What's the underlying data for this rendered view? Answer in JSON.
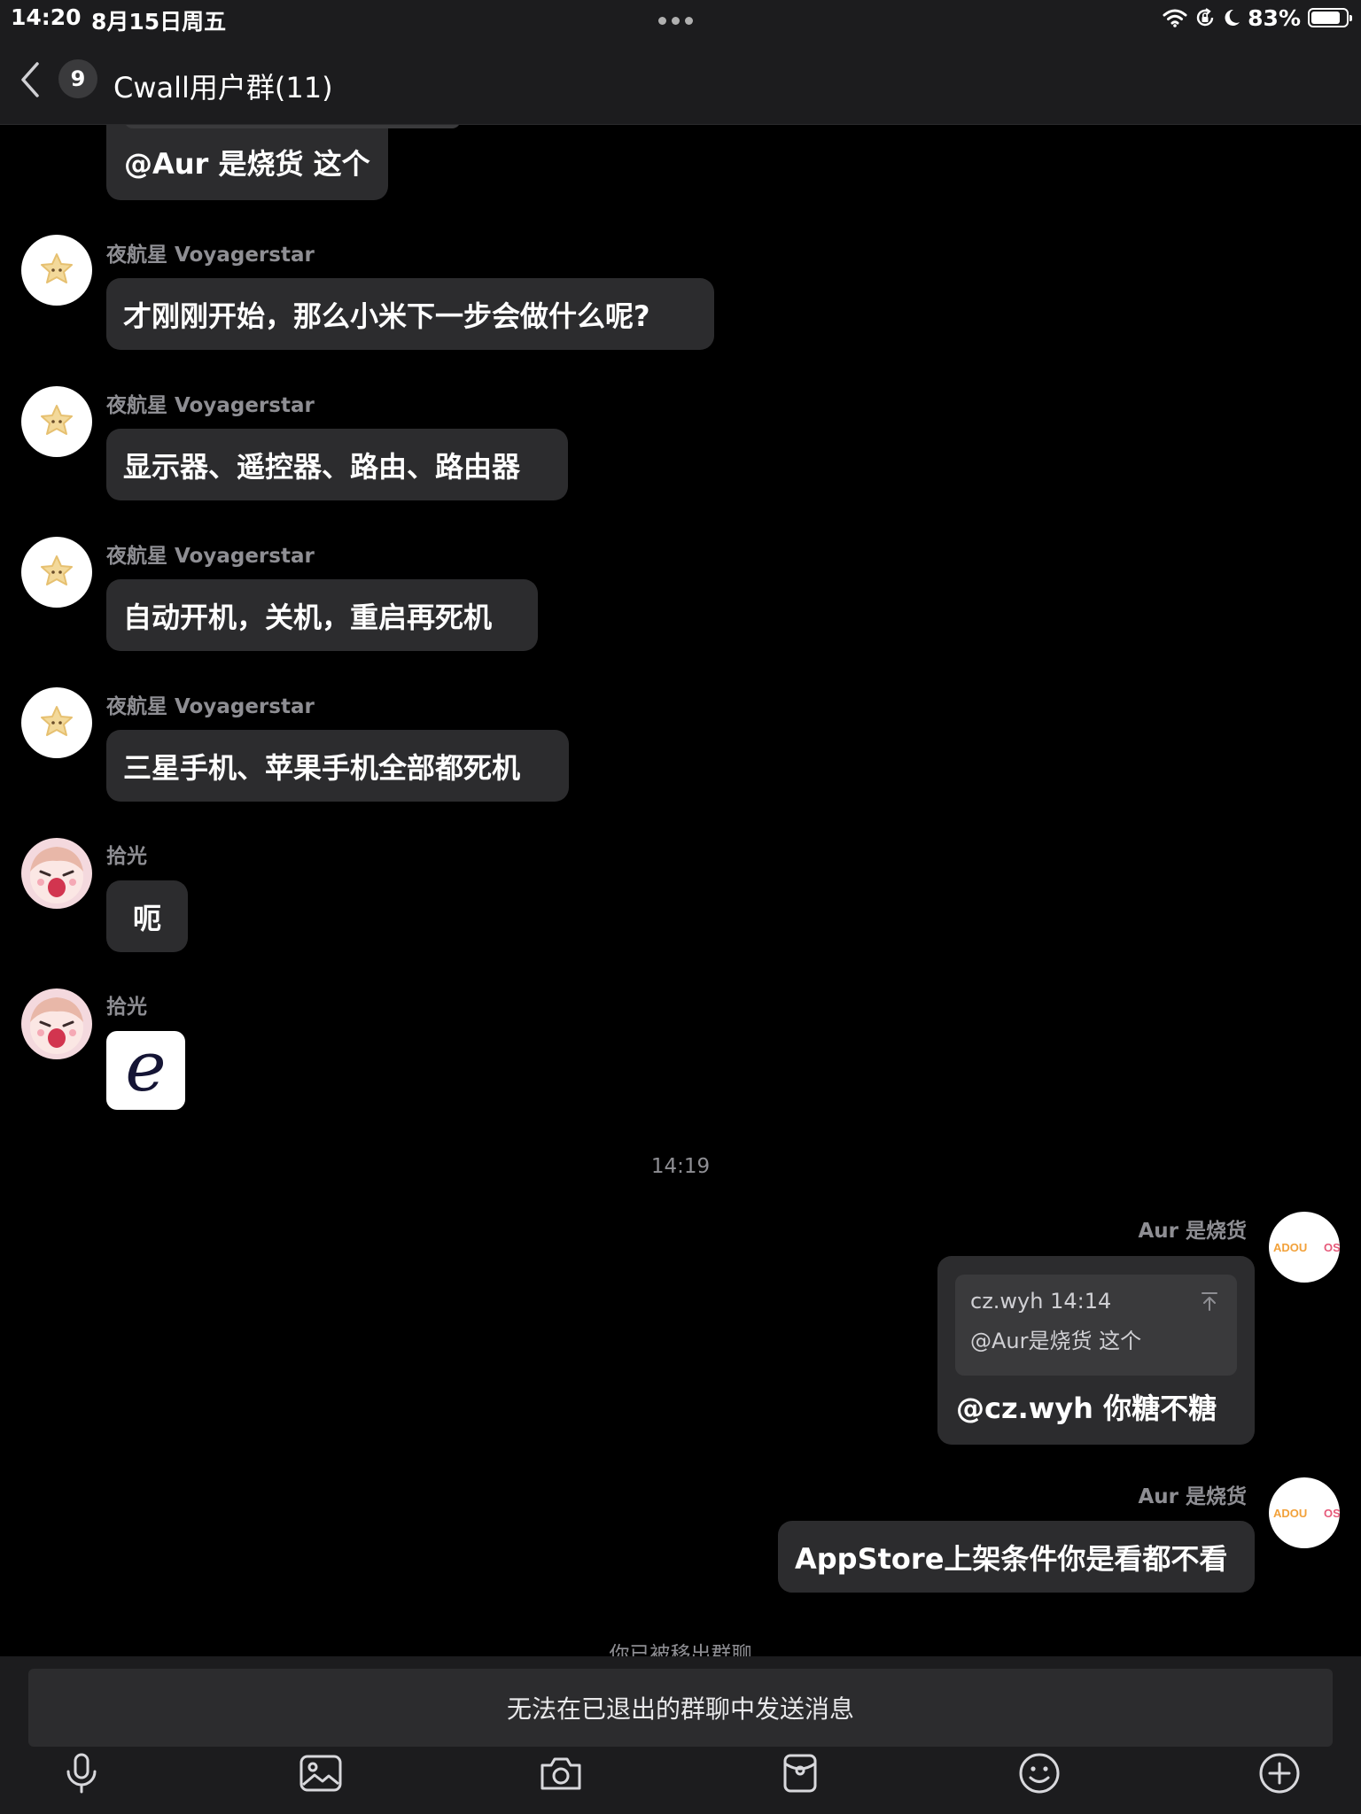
{
  "status_bar": {
    "time": "14:20",
    "date": "8月15日周五",
    "battery_text": "83%",
    "battery_level": 0.83,
    "icons": [
      "wifi-icon",
      "orientation-lock-icon",
      "moon-icon",
      "battery-icon"
    ]
  },
  "nav": {
    "back_icon": "chevron-left-icon",
    "unread_count": "9",
    "title": "Cwall用户群(11)"
  },
  "messages": [
    {
      "sender": "",
      "text": "@Aur 是烧货 这个",
      "avatar": "none",
      "side": "left"
    },
    {
      "sender": "夜航星 Voyagerstar",
      "text": "才刚刚开始，那么小米下一步会做什么呢?",
      "avatar": "star-avatar",
      "side": "left"
    },
    {
      "sender": "夜航星 Voyagerstar",
      "text": "显示器、遥控器、路由、路由器",
      "avatar": "star-avatar",
      "side": "left"
    },
    {
      "sender": "夜航星 Voyagerstar",
      "text": "自动开机，关机，重启再死机",
      "avatar": "star-avatar",
      "side": "left"
    },
    {
      "sender": "夜航星 Voyagerstar",
      "text": "三星手机、苹果手机全部都死机",
      "avatar": "star-avatar",
      "side": "left"
    },
    {
      "sender": "拾光",
      "text": "呃",
      "avatar": "anime-avatar",
      "side": "left"
    },
    {
      "sender": "拾光",
      "text": "",
      "sticker_letter": "e",
      "avatar": "anime-avatar",
      "side": "left"
    },
    {
      "sender": "Aur 是烧货",
      "quote": {
        "meta": "cz.wyh 14:14",
        "text": "@Aur是烧货 这个"
      },
      "text": "@cz.wyh 你糖不糖",
      "avatar": "adou-avatar",
      "side": "right"
    },
    {
      "sender": "Aur 是烧货",
      "text": "AppStore上架条件你是看都不看",
      "avatar": "adou-avatar",
      "side": "right"
    }
  ],
  "time_divider": "14:19",
  "avatar_text": {
    "adou_left": "ADOU",
    "adou_right": "OS"
  },
  "system_notice": "你已被移出群聊",
  "input": {
    "disabled_text": "无法在已退出的群聊中发送消息"
  },
  "toolbar": [
    "microphone-icon",
    "image-icon",
    "camera-icon",
    "red-packet-icon",
    "emoji-icon",
    "plus-icon"
  ],
  "colors": {
    "background": "#000000",
    "bar": "#1c1c1e",
    "bubble": "#2c2c2e",
    "secondary_text": "#8e8e93"
  }
}
